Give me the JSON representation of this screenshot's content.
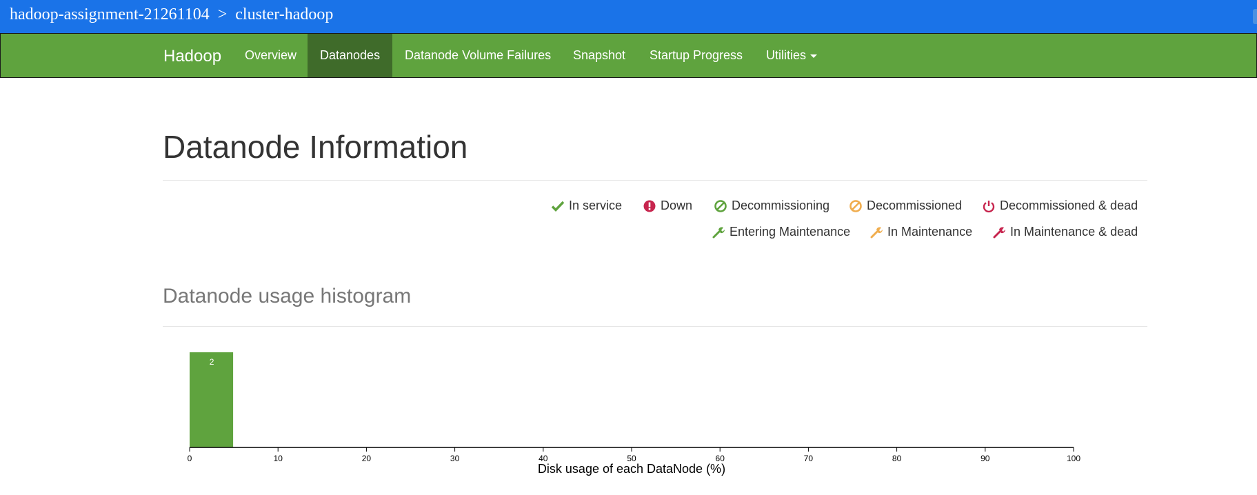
{
  "breadcrumb": {
    "project": "hadoop-assignment-21261104",
    "separator": ">",
    "cluster": "cluster-hadoop"
  },
  "navbar": {
    "brand": "Hadoop",
    "items": [
      {
        "label": "Overview",
        "active": false
      },
      {
        "label": "Datanodes",
        "active": true
      },
      {
        "label": "Datanode Volume Failures",
        "active": false
      },
      {
        "label": "Snapshot",
        "active": false
      },
      {
        "label": "Startup Progress",
        "active": false
      },
      {
        "label": "Utilities",
        "active": false,
        "dropdown": true
      }
    ]
  },
  "page": {
    "title": "Datanode Information"
  },
  "legend": {
    "items": [
      {
        "label": "In service",
        "icon": "check-icon",
        "color": "#5fa33e"
      },
      {
        "label": "Down",
        "icon": "exclamation-circle-icon",
        "color": "#c7254e"
      },
      {
        "label": "Decommissioning",
        "icon": "ban-icon",
        "color": "#5fa33e"
      },
      {
        "label": "Decommissioned",
        "icon": "ban-icon",
        "color": "#f0ad4e"
      },
      {
        "label": "Decommissioned & dead",
        "icon": "power-icon",
        "color": "#c7254e"
      },
      {
        "label": "Entering Maintenance",
        "icon": "wrench-icon",
        "color": "#5fa33e"
      },
      {
        "label": "In Maintenance",
        "icon": "wrench-icon",
        "color": "#f0ad4e"
      },
      {
        "label": "In Maintenance & dead",
        "icon": "wrench-icon",
        "color": "#c7254e"
      }
    ]
  },
  "histogram": {
    "title": "Datanode usage histogram"
  },
  "chart_data": {
    "type": "bar",
    "bins": [
      {
        "x0": 0,
        "x1": 5,
        "count": 2
      }
    ],
    "xlim": [
      0,
      100
    ],
    "xticks": [
      0,
      10,
      20,
      30,
      40,
      50,
      60,
      70,
      80,
      90,
      100
    ],
    "xlabel": "Disk usage of each DataNode (%)",
    "bar_color": "#5fa33e",
    "label_color": "#ffffff"
  }
}
